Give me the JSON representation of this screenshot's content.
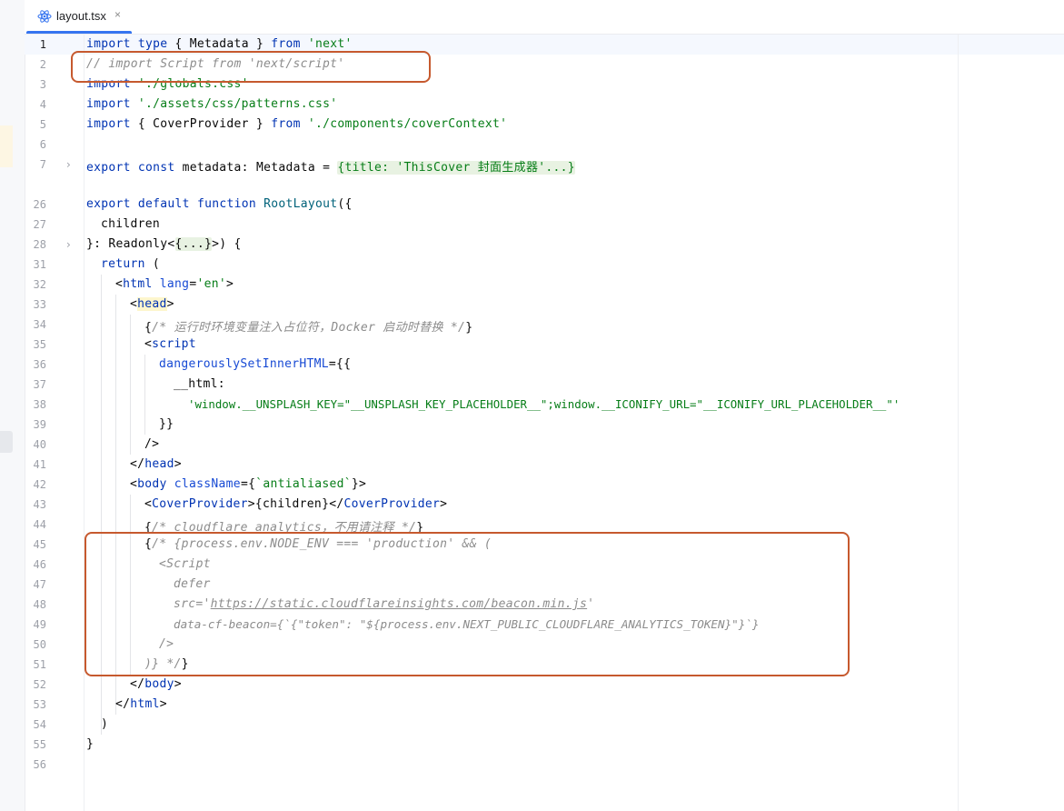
{
  "tab": {
    "title": "layout.tsx",
    "icon": "react-icon",
    "close": "×"
  },
  "line_numbers": [
    "1",
    "2",
    "3",
    "4",
    "5",
    "6",
    "7",
    "26",
    "27",
    "28",
    "31",
    "32",
    "33",
    "34",
    "35",
    "36",
    "37",
    "38",
    "39",
    "40",
    "41",
    "42",
    "43",
    "44",
    "45",
    "46",
    "47",
    "48",
    "49",
    "50",
    "51",
    "52",
    "53",
    "54",
    "55",
    "56"
  ],
  "code": {
    "l1": {
      "kw1": "import",
      "kw2": "type",
      "t1": " { Metadata } ",
      "kw3": "from",
      "str": "'next'"
    },
    "l2": {
      "comment": "// import Script from 'next/script'"
    },
    "l3": {
      "kw": "import",
      "str": "'./globals.css'"
    },
    "l4": {
      "kw": "import",
      "str": "'./assets/css/patterns.css'"
    },
    "l5": {
      "kw1": "import",
      "t1": " { CoverProvider } ",
      "kw2": "from",
      "str": "'./components/coverContext'"
    },
    "l7": {
      "kw1": "export",
      "kw2": "const",
      "t1": " metadata: Metadata = ",
      "folded": "{title: 'ThisCover 封面生成器'...}"
    },
    "l26": {
      "kw1": "export",
      "kw2": "default",
      "kw3": "function",
      "fn": "RootLayout",
      "t1": "({"
    },
    "l27": {
      "t1": "children"
    },
    "l28": {
      "t1": "}: Readonly<",
      "folded": "{...}",
      "t2": ">) {"
    },
    "l31": {
      "kw": "return",
      "t1": " ("
    },
    "l32": {
      "t1": "<",
      "tag": "html",
      "attr": "lang",
      "t2": "=",
      "str": "'en'",
      "t3": ">"
    },
    "l33": {
      "t1": "<",
      "tag": "head",
      "t2": ">"
    },
    "l34": {
      "t1": "{",
      "comment": "/* 运行时环境变量注入占位符，Docker 启动时替换 */",
      "t2": "}"
    },
    "l35": {
      "t1": "<",
      "tag": "script"
    },
    "l36": {
      "attr": "dangerouslySetInnerHTML",
      "t1": "={{"
    },
    "l37": {
      "t1": "__html:"
    },
    "l38": {
      "str": "'window.__UNSPLASH_KEY=\"__UNSPLASH_KEY_PLACEHOLDER__\";window.__ICONIFY_URL=\"__ICONIFY_URL_PLACEHOLDER__\"'"
    },
    "l39": {
      "t1": "}}"
    },
    "l40": {
      "t1": "/>"
    },
    "l41": {
      "t1": "</",
      "tag": "head",
      "t2": ">"
    },
    "l42": {
      "t1": "<",
      "tag": "body",
      "attr": "className",
      "t2": "={",
      "str": "`antialiased`",
      "t3": "}>"
    },
    "l43": {
      "t1": "<",
      "comp": "CoverProvider",
      "t2": ">{children}</",
      "comp2": "CoverProvider",
      "t3": ">"
    },
    "l44": {
      "t1": "{",
      "comment": "/* cloudflare analytics，不用请注释 */",
      "t2": "}"
    },
    "l45": {
      "t1": "{",
      "comment": "/* {process.env.NODE_ENV === 'production' && ("
    },
    "l46": {
      "comment": "<Script"
    },
    "l47": {
      "comment": "defer"
    },
    "l48": {
      "c1": "src='",
      "url": "https://static.cloudflareinsights.com/beacon.min.js",
      "c2": "'"
    },
    "l49": {
      "comment": "data-cf-beacon={`{\"token\": \"${process.env.NEXT_PUBLIC_CLOUDFLARE_ANALYTICS_TOKEN}\"}`}"
    },
    "l50": {
      "comment": "/>"
    },
    "l51": {
      "comment": ")} */",
      "t1": "}"
    },
    "l52": {
      "t1": "</",
      "tag": "body",
      "t2": ">"
    },
    "l53": {
      "t1": "</",
      "tag": "html",
      "t2": ">"
    },
    "l54": {
      "t1": ")"
    },
    "l55": {
      "t1": "}"
    },
    "l56": {
      "t1": ""
    }
  },
  "colors": {
    "annotation": "#c6592e",
    "tab_underline": "#3574f0"
  }
}
